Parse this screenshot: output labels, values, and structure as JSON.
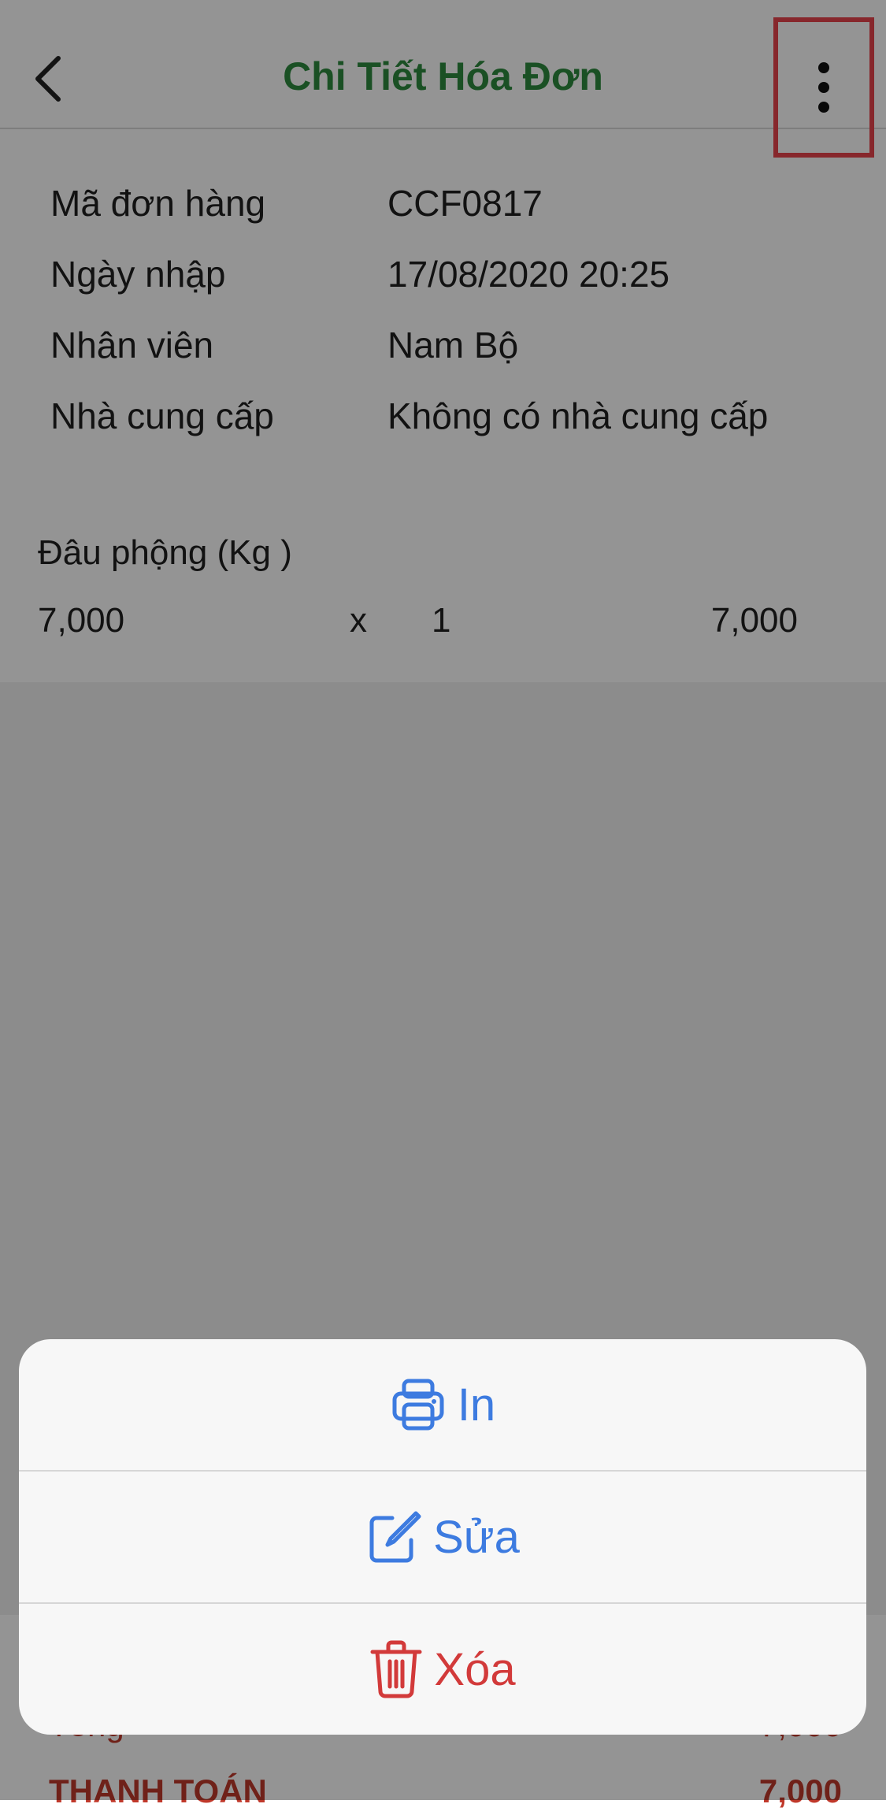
{
  "header": {
    "title": "Chi Tiết Hóa Đơn"
  },
  "info": [
    {
      "label": "Mã đơn hàng",
      "value": "CCF0817"
    },
    {
      "label": "Ngày nhập",
      "value": "17/08/2020 20:25"
    },
    {
      "label": "Nhân viên",
      "value": "Nam Bộ"
    },
    {
      "label": "Nhà cung cấp",
      "value": "Không có nhà cung cấp"
    }
  ],
  "item": {
    "name": "Đâu phộng (Kg )",
    "price": "7,000",
    "mult": "x",
    "qty": "1",
    "total": "7,000"
  },
  "footer": {
    "subtotal_label": "Tổng",
    "subtotal_value": "7,000",
    "pay_label": "THANH TOÁN",
    "pay_value": "7,000"
  },
  "actions": {
    "print": "In",
    "edit": "Sửa",
    "delete": "Xóa"
  },
  "colors": {
    "title": "#2e8b3f",
    "action_blue": "#3d7be0",
    "action_red": "#d23a3a",
    "highlight": "#e8444c"
  }
}
